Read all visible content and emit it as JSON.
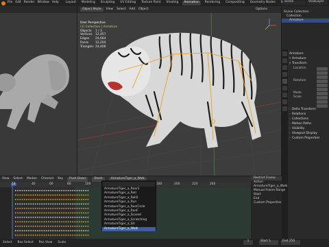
{
  "topbar": {
    "menus": [
      "File",
      "Edit",
      "Render",
      "Window",
      "Help"
    ],
    "workspaces": [
      "Layout",
      "Modeling",
      "Sculpting",
      "UV Editing",
      "Texture Paint",
      "Shading",
      "Animation",
      "Rendering",
      "Compositing",
      "Geometry Nodes",
      "Scripting"
    ],
    "active_workspace": "Animation",
    "scene": "Scene",
    "view_layer": "ViewLayer"
  },
  "main_view": {
    "header": {
      "mode": "Object Mode",
      "menus": [
        "View",
        "Select",
        "Add",
        "Object"
      ],
      "options": "Options"
    },
    "stats": {
      "view": "User Perspective",
      "collection": "(1) Collection | Armature",
      "rows": [
        {
          "k": "Objects",
          "v": "1 / 3"
        },
        {
          "k": "Vertices",
          "v": "12,457"
        },
        {
          "k": "Edges",
          "v": "24,664"
        },
        {
          "k": "Faces",
          "v": "12,204"
        },
        {
          "k": "Triangles",
          "v": "24,408"
        }
      ]
    }
  },
  "outliner": {
    "rows": [
      {
        "label": "Scene Collection",
        "sel": false
      },
      {
        "label": "Collection",
        "sel": false
      },
      {
        "label": "Armature",
        "sel": true
      }
    ]
  },
  "properties": {
    "object_name": "Armature",
    "sections": [
      "Armature",
      "Transform",
      "Location",
      "Rotation",
      "Mode",
      "Scale",
      "Delta Transform",
      "Relations",
      "Collections",
      "Motion Paths",
      "Visibility",
      "Viewport Display",
      "Custom Properties"
    ]
  },
  "dopesheet": {
    "header": [
      "View",
      "Select",
      "Marker",
      "Channel",
      "Key"
    ],
    "mode": "Action Editor",
    "push_down": "Push Down",
    "stash": "Stash",
    "action": "ArmatureTiger_a_Walk",
    "ruler": [
      "10",
      "40",
      "60",
      "80",
      "100",
      "120",
      "140",
      "160",
      "180",
      "200",
      "220",
      "240"
    ]
  },
  "action_list": {
    "items": [
      {
        "label": "ArmatureTiger_a_Roar1",
        "sel": false
      },
      {
        "label": "ArmatureTiger_a_Roll",
        "sel": false
      },
      {
        "label": "ArmatureTiger_a_Roll2",
        "sel": false
      },
      {
        "label": "ArmatureTiger_a_Run",
        "sel": false
      },
      {
        "label": "ArmatureTiger_a_RunCircle",
        "sel": false
      },
      {
        "label": "ArmatureTiger_a_RunF",
        "sel": false
      },
      {
        "label": "ArmatureTiger_a_Scared",
        "sel": false
      },
      {
        "label": "ArmatureTiger_a_Scratching",
        "sel": false
      },
      {
        "label": "ArmatureTiger_a_Sit",
        "sel": false
      },
      {
        "label": "ArmatureTiger_a_Walk",
        "sel": true
      }
    ]
  },
  "nla_panel": {
    "title": "Restrict Frame",
    "rows": [
      "Action",
      "ArmatureTiger_a_Walk",
      "Manual Frame Range",
      "Start",
      "End",
      "Custom Properties"
    ]
  },
  "status": {
    "items": [
      "Select",
      "Box Select",
      "Pan View",
      "Scale"
    ],
    "frame": "1",
    "start_label": "Start 1",
    "end_label": "End 250"
  },
  "colors": {
    "accent": "#e87d0d",
    "selection": "#3d5fa3",
    "keyframe": "#e8a317"
  }
}
